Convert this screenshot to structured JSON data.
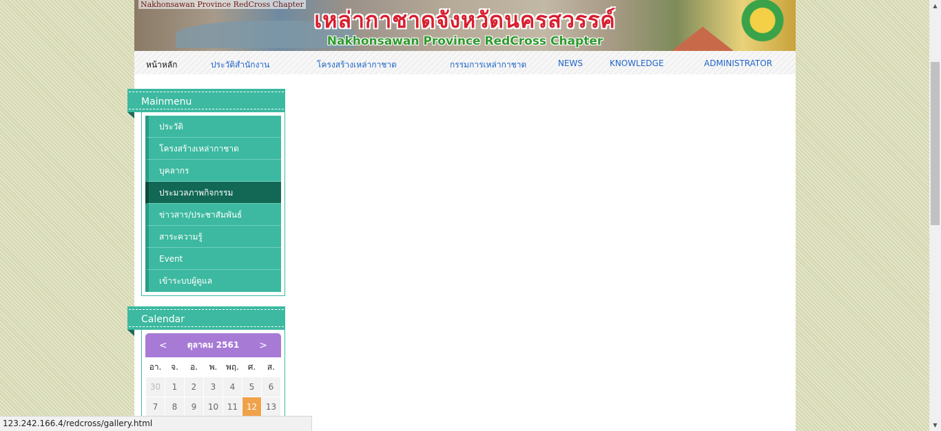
{
  "banner": {
    "small_title": "Nakhonsawan Province RedCross Chapter",
    "thai_title": "เหล่ากาชาดจังหวัดนครสวรรค์",
    "english_title": "Nakhonsawan Province RedCross Chapter"
  },
  "nav": {
    "items": [
      {
        "label": "หน้าหลัก"
      },
      {
        "label": "ประวัติสำนักงาน"
      },
      {
        "label": "โครงสร้างเหล่ากาชาด"
      },
      {
        "label": "กรรมการเหล่ากาชาด"
      },
      {
        "label": "NEWS"
      },
      {
        "label": "KNOWLEDGE"
      },
      {
        "label": "ADMINISTRATOR"
      }
    ]
  },
  "mainmenu": {
    "title": "Mainmenu",
    "items": [
      {
        "label": "ประวัติ"
      },
      {
        "label": "โครงสร้างเหล่ากาชาด"
      },
      {
        "label": "บุคลากร"
      },
      {
        "label": "ประมวลภาพกิจกรรม"
      },
      {
        "label": "ข่าวสาร/ประชาสัมพันธ์"
      },
      {
        "label": "สาระความรู้"
      },
      {
        "label": "Event"
      },
      {
        "label": "เข้าระบบผู้ดูแล"
      }
    ]
  },
  "calendar": {
    "title": "Calendar",
    "prev": "<",
    "next": ">",
    "month_label": "ตุลาคม 2561",
    "weekdays": [
      "อา.",
      "จ.",
      "อ.",
      "พ.",
      "พฤ.",
      "ศ.",
      "ส."
    ],
    "rows": [
      [
        "30",
        "1",
        "2",
        "3",
        "4",
        "5",
        "6"
      ],
      [
        "7",
        "8",
        "9",
        "10",
        "11",
        "12",
        "13"
      ]
    ]
  },
  "status_bar": {
    "url": "123.242.166.4/redcross/gallery.html"
  },
  "colors": {
    "accent_teal": "#3cb9a0",
    "active_menu": "#126855",
    "calendar_header": "#a77ad6",
    "today": "#f0a24a",
    "link": "#1f64c8"
  }
}
